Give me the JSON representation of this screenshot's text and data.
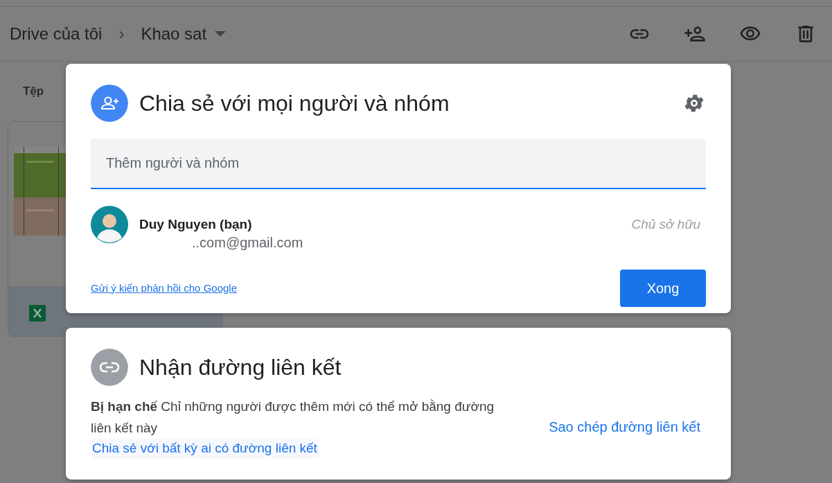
{
  "breadcrumb": {
    "root": "Drive của tôi",
    "separator": "›",
    "current": "Khao sat"
  },
  "side_label": "Tệp",
  "share_dialog": {
    "title": "Chia sẻ với mọi người và nhóm",
    "input": {
      "placeholder": "Thêm người và nhóm"
    },
    "people": [
      {
        "name": "Duy Nguyen (bạn)",
        "email": "..com@gmail.com",
        "role": "Chủ sở hữu"
      }
    ],
    "feedback_link": "Gửi ý kiến phản hồi cho Google",
    "done_button": "Xong"
  },
  "link_dialog": {
    "title": "Nhận đường liên kết",
    "description": "**Bị hạn chế** Chỉ những người được thêm mới có thể mở bằng đường liên kết này",
    "share_link": "Chia sẻ với bất kỳ ai có đường liên kết",
    "copy_link": "Sao chép đường liên kết"
  }
}
